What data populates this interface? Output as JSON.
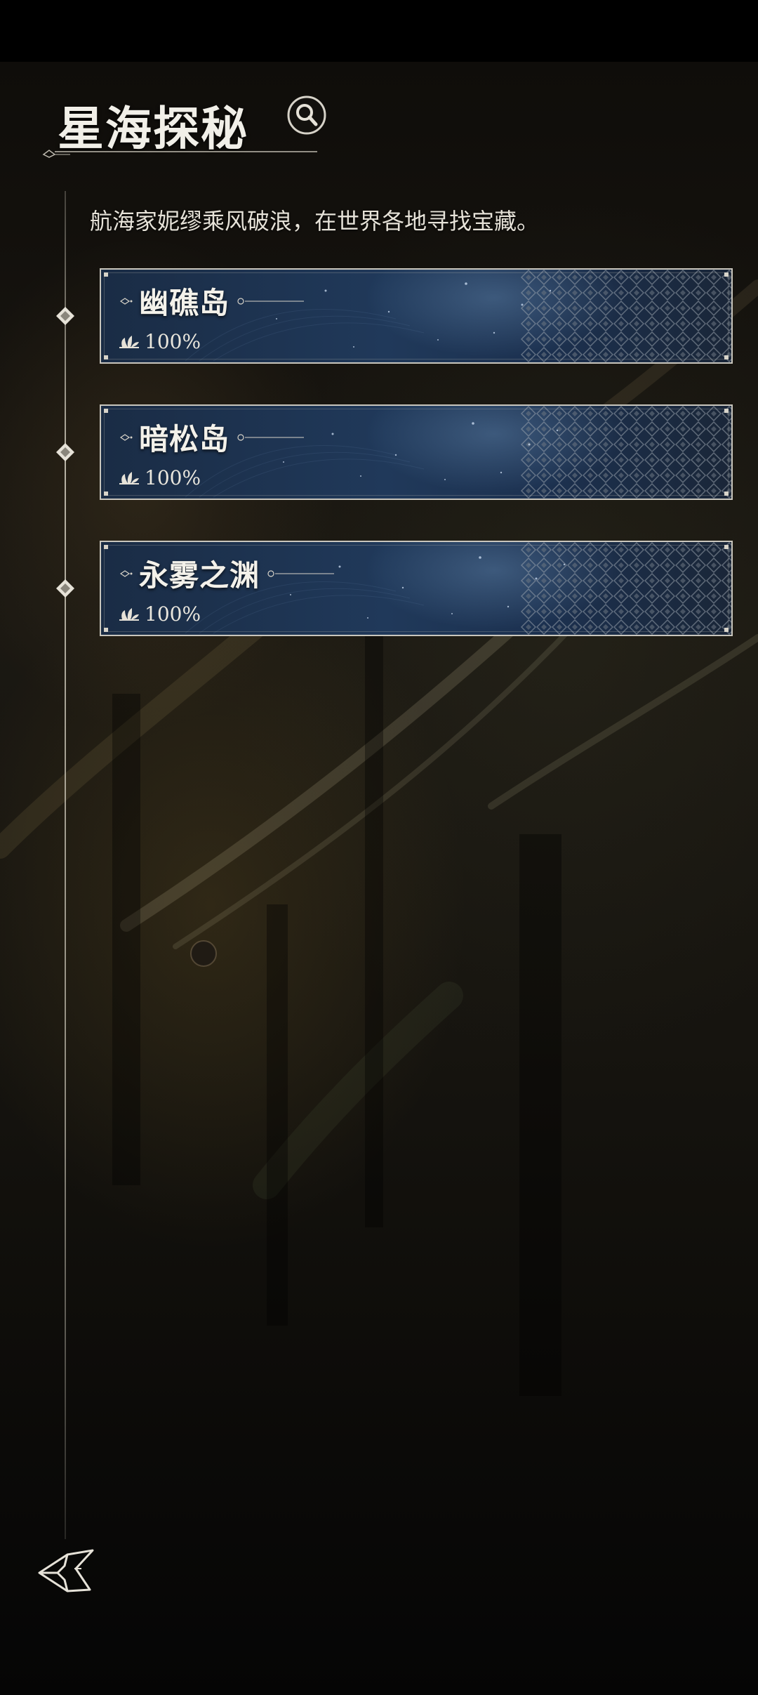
{
  "header": {
    "title": "星海探秘",
    "search_icon": "magnifier-icon"
  },
  "description": "航海家妮缪乘风破浪，在世界各地寻找宝藏。",
  "islands": [
    {
      "name": "幽礁岛",
      "progress": "100%",
      "progress_icon": "lotus-icon"
    },
    {
      "name": "暗松岛",
      "progress": "100%",
      "progress_icon": "lotus-icon"
    },
    {
      "name": "永雾之渊",
      "progress": "100%",
      "progress_icon": "lotus-icon"
    }
  ],
  "footer": {
    "back_icon": "back-arrow-icon"
  },
  "colors": {
    "card_bg": "#20395a",
    "card_border": "#c9c6bd",
    "text": "#f1efe8",
    "background": "#16140f"
  }
}
